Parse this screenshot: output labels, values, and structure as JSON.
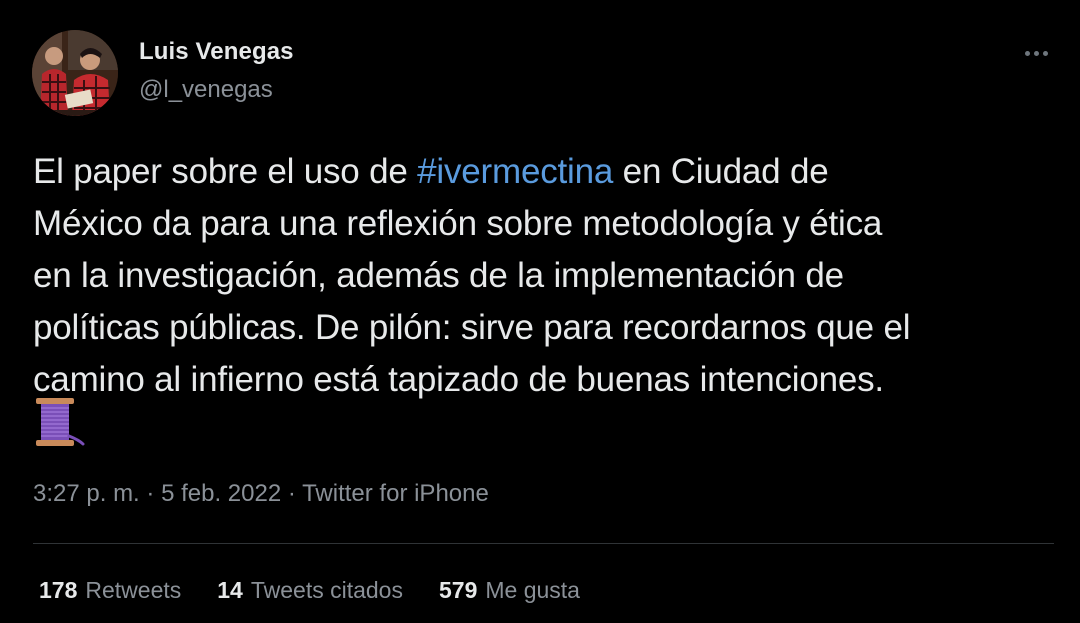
{
  "user": {
    "display_name": "Luis Venegas",
    "handle": "@l_venegas"
  },
  "tweet": {
    "lines": [
      {
        "before": "El paper sobre el uso de ",
        "hashtag": "#ivermectina",
        "after": " en Ciudad de"
      },
      {
        "text": "México da para una reflexión sobre metodología y ética"
      },
      {
        "text": "en la investigación, además de la implementación de"
      },
      {
        "text": "políticas públicas. De pilón: sirve para recordarnos que el"
      },
      {
        "text": "camino al infierno está tapizado de buenas intenciones."
      }
    ],
    "emoji": "thread-emoji"
  },
  "meta": {
    "time": "3:27 p. m.",
    "sep1": " · ",
    "date": "5 feb. 2022",
    "sep2": " · ",
    "source": "Twitter for iPhone"
  },
  "stats": {
    "retweets_count": "178",
    "retweets_label": "Retweets",
    "quotes_count": "14",
    "quotes_label": "Tweets citados",
    "likes_count": "579",
    "likes_label": "Me gusta"
  },
  "colors": {
    "background": "#000000",
    "text": "#e7e9ea",
    "secondary": "#8b9198",
    "link": "#5a9bde",
    "divider": "#2f3336"
  }
}
